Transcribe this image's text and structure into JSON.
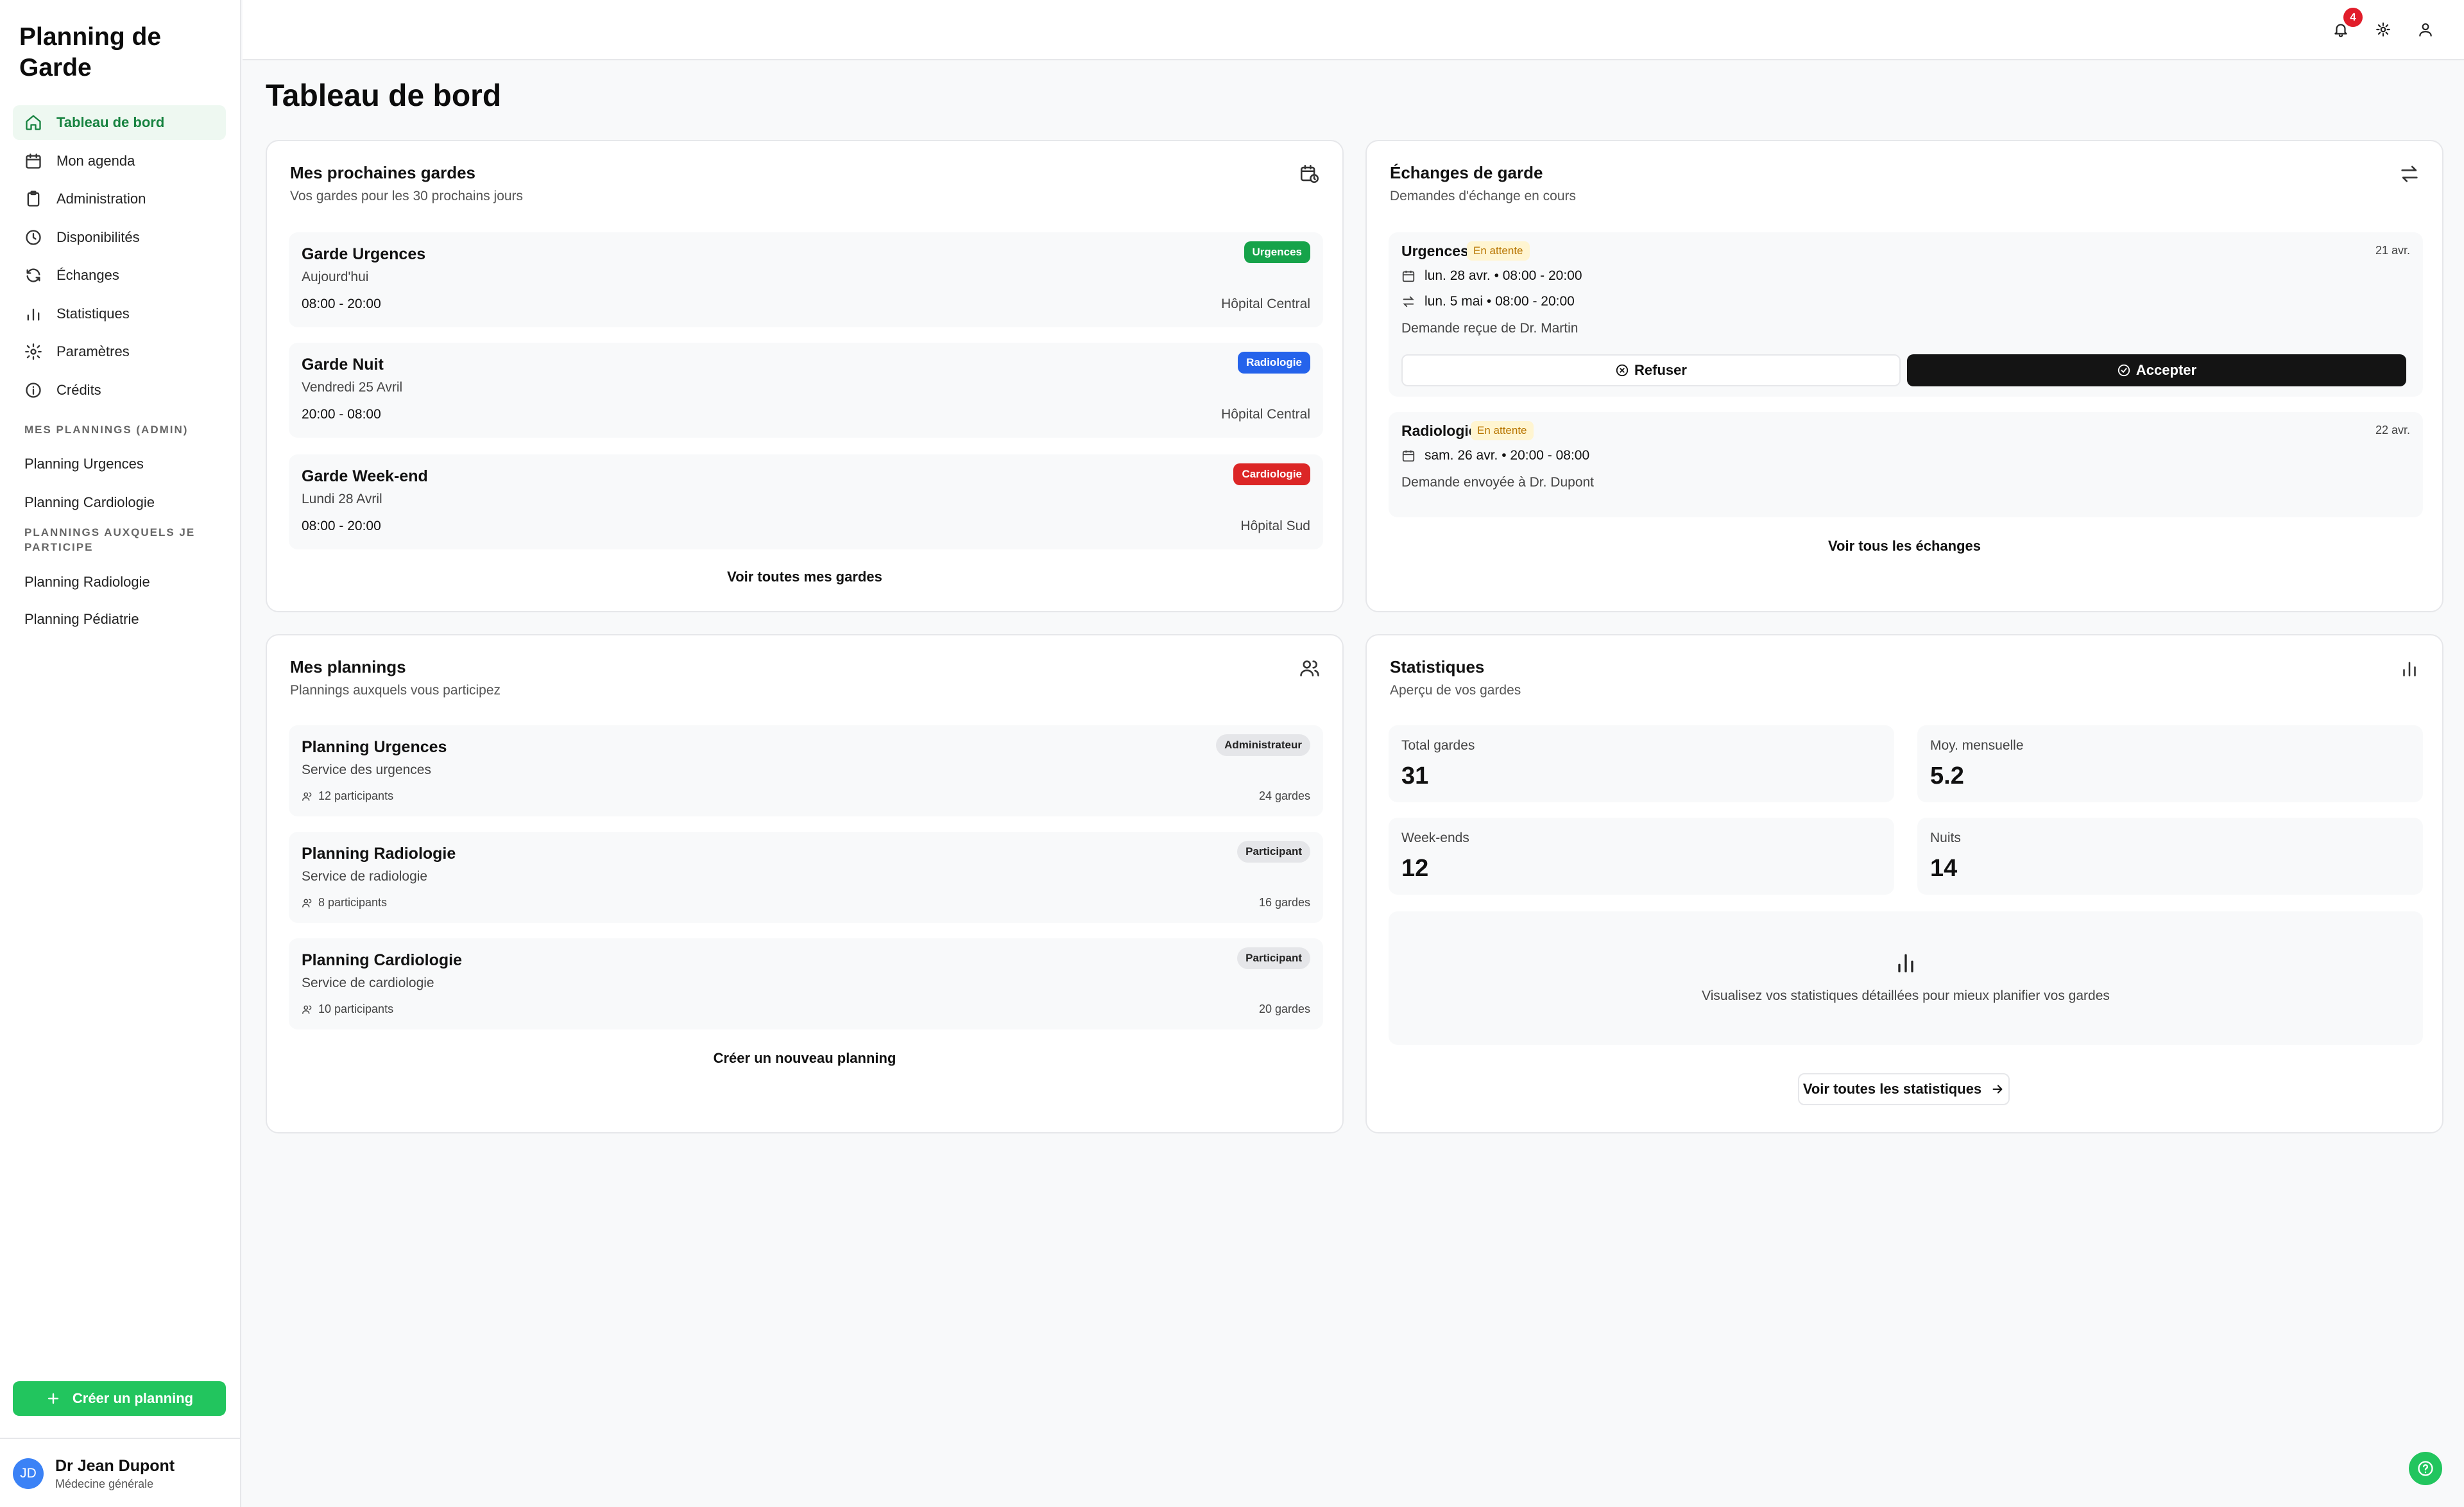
{
  "app": {
    "title": "Planning de Garde"
  },
  "sidebar": {
    "nav": [
      {
        "label": "Tableau de bord",
        "icon": "home-icon",
        "active": true
      },
      {
        "label": "Mon agenda",
        "icon": "calendar-icon"
      },
      {
        "label": "Administration",
        "icon": "clipboard-icon"
      },
      {
        "label": "Disponibilités",
        "icon": "clock-icon"
      },
      {
        "label": "Échanges",
        "icon": "refresh-icon"
      },
      {
        "label": "Statistiques",
        "icon": "bar-chart-icon"
      },
      {
        "label": "Paramètres",
        "icon": "gear-icon"
      },
      {
        "label": "Crédits",
        "icon": "info-icon"
      }
    ],
    "admin_section": "MES PLANNINGS (ADMIN)",
    "admin_items": [
      "Planning Urgences",
      "Planning Cardiologie"
    ],
    "participant_section": "PLANNINGS AUXQUELS JE PARTICIPE",
    "participant_items": [
      "Planning Radiologie",
      "Planning Pédiatrie"
    ],
    "create_button": "Créer un planning",
    "user": {
      "initials": "JD",
      "name": "Dr Jean Dupont",
      "role": "Médecine générale"
    }
  },
  "header": {
    "notifications_count": "4"
  },
  "page": {
    "title": "Tableau de bord"
  },
  "shifts_card": {
    "title": "Mes prochaines gardes",
    "subtitle": "Vos gardes pour les 30 prochains jours",
    "items": [
      {
        "title": "Garde Urgences",
        "date": "Aujourd'hui",
        "time": "08:00 - 20:00",
        "location": "Hôpital Central",
        "badge": "Urgences",
        "badge_color": "#16a34a"
      },
      {
        "title": "Garde Nuit",
        "date": "Vendredi 25 Avril",
        "time": "20:00 - 08:00",
        "location": "Hôpital Central",
        "badge": "Radiologie",
        "badge_color": "#2563eb"
      },
      {
        "title": "Garde Week-end",
        "date": "Lundi 28 Avril",
        "time": "08:00 - 20:00",
        "location": "Hôpital Sud",
        "badge": "Cardiologie",
        "badge_color": "#dc2626"
      }
    ],
    "link": "Voir toutes mes gardes"
  },
  "exchanges_card": {
    "title": "Échanges de garde",
    "subtitle": "Demandes d'échange en cours",
    "items": [
      {
        "service": "Urgences",
        "status": "En attente",
        "date": "21 avr.",
        "line1": "lun. 28 avr. • 08:00 - 20:00",
        "line2": "lun. 5 mai • 08:00 - 20:00",
        "note": "Demande reçue de Dr. Martin",
        "refuse": "Refuser",
        "accept": "Accepter"
      },
      {
        "service": "Radiologie",
        "status": "En attente",
        "date": "22 avr.",
        "line1": "sam. 26 avr. • 20:00 - 08:00",
        "note": "Demande envoyée à Dr. Dupont"
      }
    ],
    "link": "Voir tous les échanges"
  },
  "plannings_card": {
    "title": "Mes plannings",
    "subtitle": "Plannings auxquels vous participez",
    "items": [
      {
        "title": "Planning Urgences",
        "service": "Service des urgences",
        "participants": "12 participants",
        "shifts": "24 gardes",
        "role": "Administrateur"
      },
      {
        "title": "Planning Radiologie",
        "service": "Service de radiologie",
        "participants": "8 participants",
        "shifts": "16 gardes",
        "role": "Participant"
      },
      {
        "title": "Planning Cardiologie",
        "service": "Service de cardiologie",
        "participants": "10 participants",
        "shifts": "20 gardes",
        "role": "Participant"
      }
    ],
    "link": "Créer un nouveau planning"
  },
  "stats_card": {
    "title": "Statistiques",
    "subtitle": "Aperçu de vos gardes",
    "stats": [
      {
        "label": "Total gardes",
        "value": "31"
      },
      {
        "label": "Moy. mensuelle",
        "value": "5.2"
      },
      {
        "label": "Week-ends",
        "value": "12"
      },
      {
        "label": "Nuits",
        "value": "14"
      }
    ],
    "info": "Visualisez vos statistiques détaillées pour mieux planifier vos gardes",
    "button": "Voir toutes les statistiques"
  },
  "colors": {
    "accent": "#22c55e",
    "active_bg": "#eef8f1",
    "active_text": "#16823f",
    "pending_bg": "#fff5d1",
    "pending_text": "#b87500"
  }
}
